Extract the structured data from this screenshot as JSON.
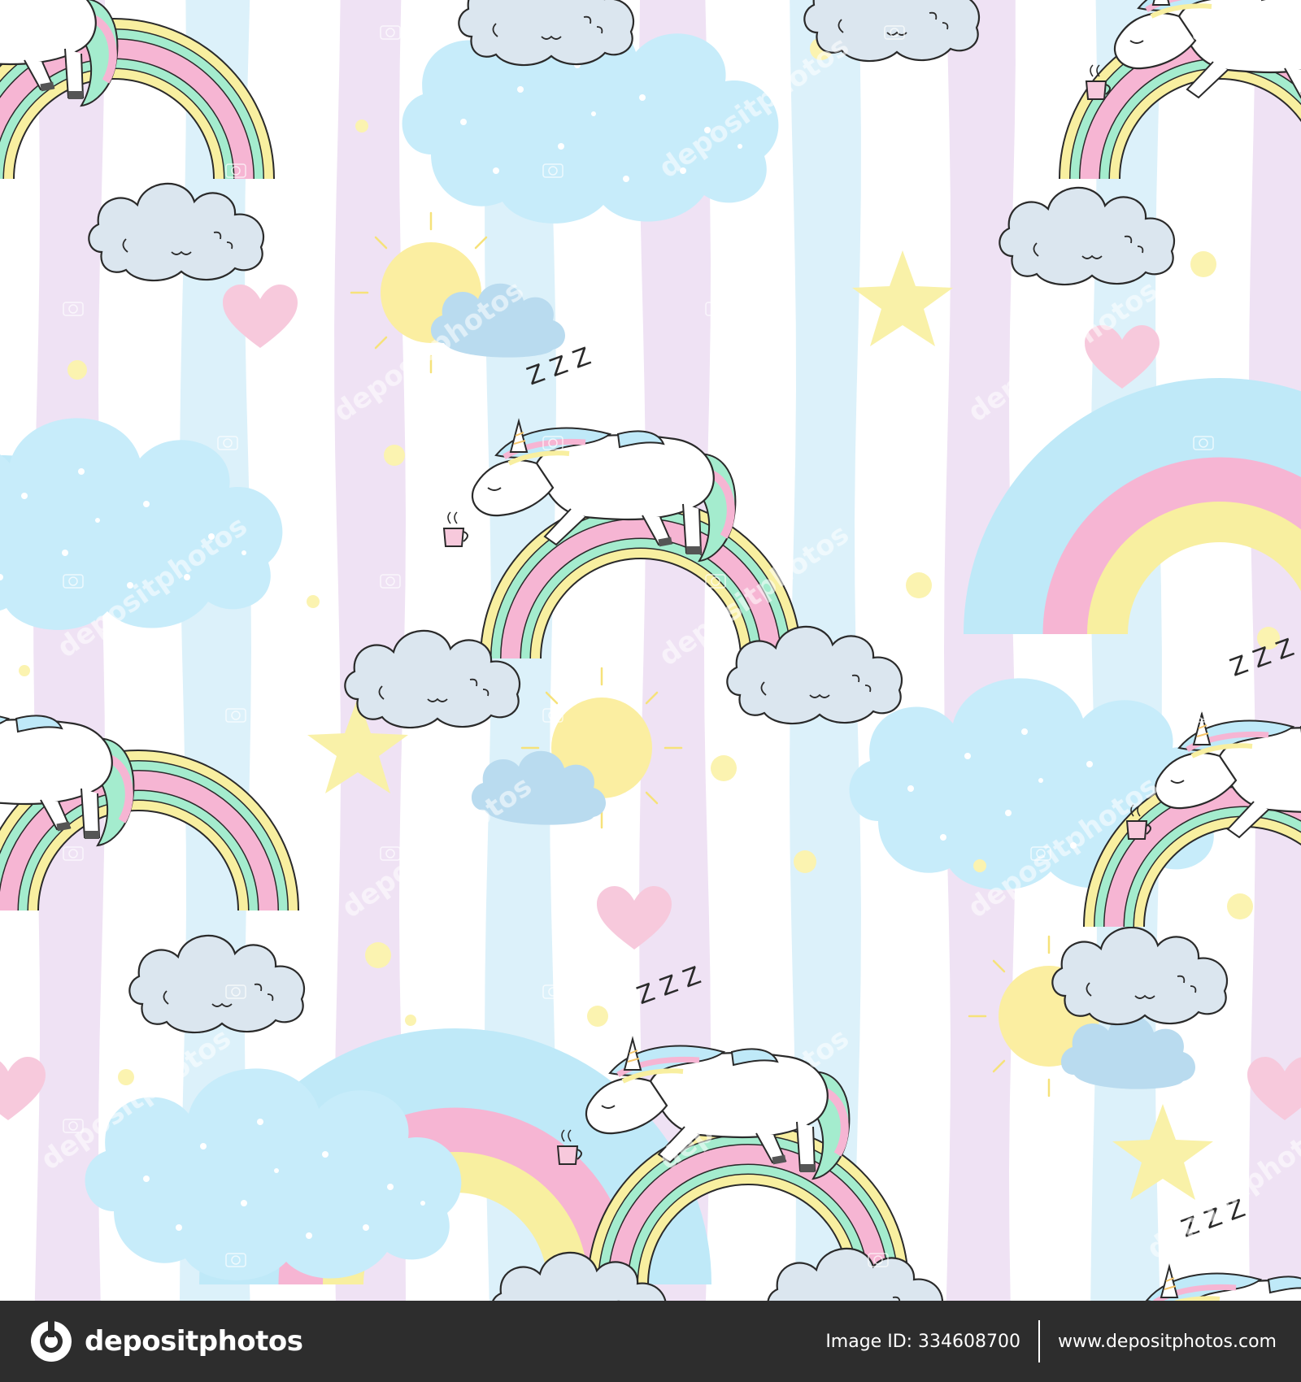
{
  "artwork": {
    "stripe_colors": [
      "#efe2f4",
      "#dcf1fa"
    ],
    "palette": {
      "pink": "#f6b5d3",
      "yellow": "#f8efa0",
      "mint": "#a4ecce",
      "sky": "#bfe9f8",
      "cloud_blue": "#c7ecfa",
      "cloud_grey": "#dbe6ef",
      "heart": "#f7c9dc",
      "star": "#f9f1a8",
      "sun": "#fbeea1",
      "outline": "#2a2a2a"
    },
    "snore_text": "Z Z Z",
    "watermark_text": "depositphotos"
  },
  "footer": {
    "brand_name": "depositphotos",
    "image_id": "Image ID: 334608700",
    "site_url": "www.depositphotos.com"
  }
}
